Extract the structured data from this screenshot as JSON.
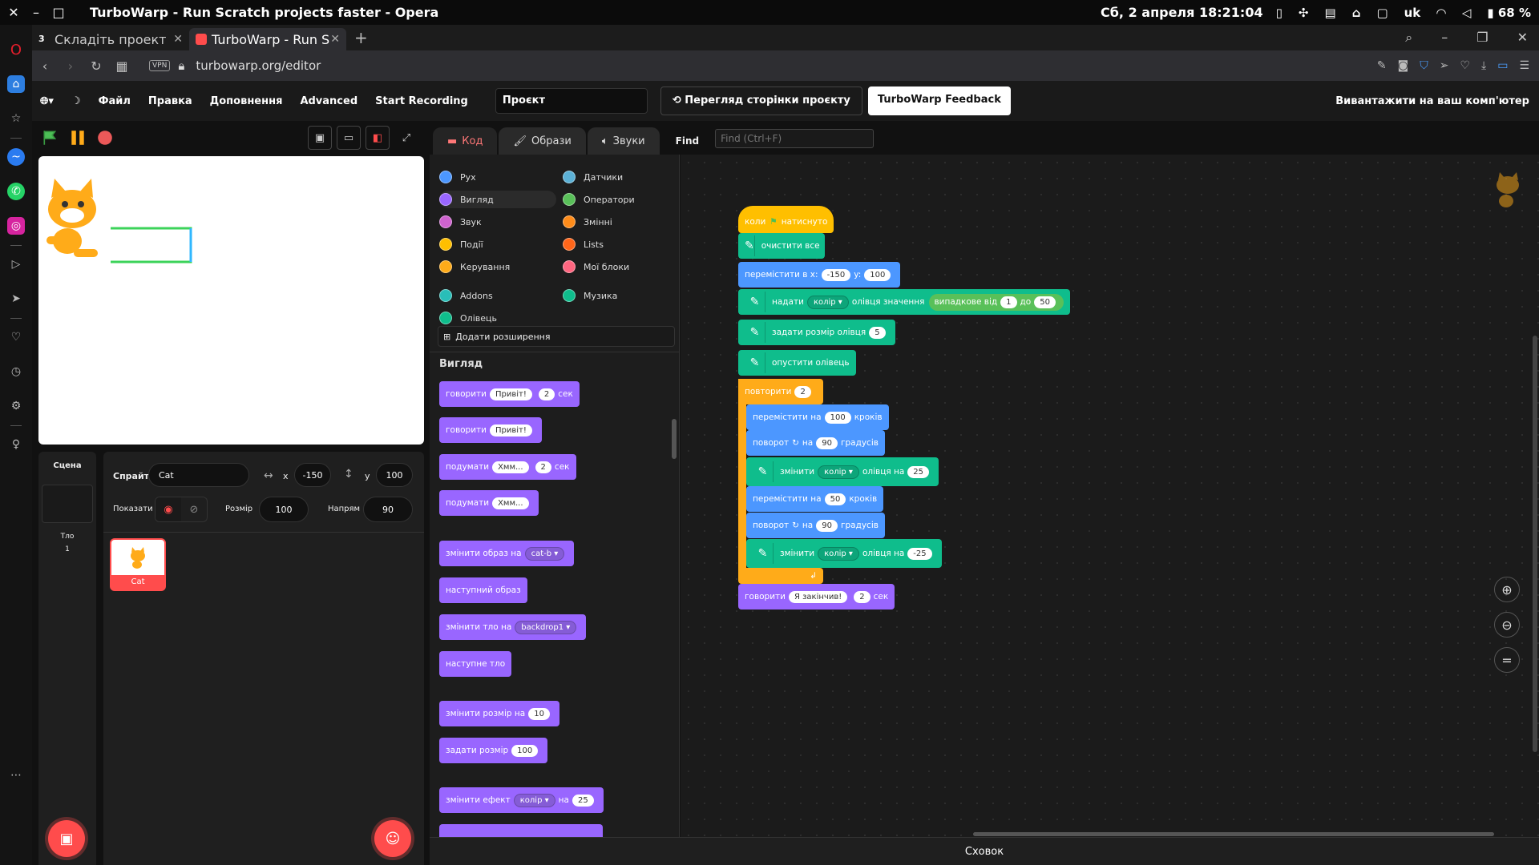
{
  "os": {
    "title": "TurboWarp - Run Scratch projects faster - Opera",
    "datetime": "Сб, 2 апреля 18:21:04",
    "lang": "uk",
    "battery": "68 %"
  },
  "tabs": [
    {
      "label": "Складіть проект",
      "badge": "3"
    },
    {
      "label": "TurboWarp - Run S"
    }
  ],
  "address": {
    "url": "turbowarp.org/editor",
    "vpn": "VPN"
  },
  "menu": {
    "file": "Файл",
    "edit": "Правка",
    "addons": "Доповнення",
    "advanced": "Advanced",
    "record": "Start Recording",
    "project_title": "Проєкт",
    "view_page": "Перегляд сторінки проєкту",
    "feedback": "TurboWarp Feedback",
    "save": "Вивантажити на ваш комп'ютер"
  },
  "code_tabs": {
    "code": "Код",
    "costumes": "Образи",
    "sounds": "Звуки",
    "find": "Find",
    "find_placeholder": "Find (Ctrl+F)"
  },
  "categories": [
    {
      "label": "Рух",
      "color": "#4c97ff"
    },
    {
      "label": "Датчики",
      "color": "#5cb1d6"
    },
    {
      "label": "Вигляд",
      "color": "#9966ff"
    },
    {
      "label": "Оператори",
      "color": "#59c059"
    },
    {
      "label": "Звук",
      "color": "#cf63cf"
    },
    {
      "label": "Змінні",
      "color": "#ff8c1a"
    },
    {
      "label": "Події",
      "color": "#ffbf00"
    },
    {
      "label": "Lists",
      "color": "#ff661a"
    },
    {
      "label": "Керування",
      "color": "#ffab19"
    },
    {
      "label": "Мої блоки",
      "color": "#ff6680"
    },
    {
      "label": "Addons",
      "color": "#29beb8"
    },
    {
      "label": "Музика",
      "color": "#0fbd8c"
    },
    {
      "label": "Олівець",
      "color": "#0fbd8c"
    }
  ],
  "extensions_button": "Додати розширення",
  "palette_heading": "Вигляд",
  "palette": {
    "say_for": [
      "говорити",
      "Привіт!",
      "2",
      "сек"
    ],
    "say": [
      "говорити",
      "Привіт!"
    ],
    "think_for": [
      "подумати",
      "Хмм...",
      "2",
      "сек"
    ],
    "think": [
      "подумати",
      "Хмм..."
    ],
    "switch_costume": [
      "змінити образ на",
      "cat-b"
    ],
    "next_costume": "наступний образ",
    "switch_backdrop": [
      "змінити тло на",
      "backdrop1"
    ],
    "next_backdrop": "наступне тло",
    "change_size": [
      "змінити розмір на",
      "10"
    ],
    "set_size": [
      "задати розмір",
      "100"
    ],
    "change_effect": [
      "змінити ефект",
      "колір",
      "на",
      "25"
    ]
  },
  "script": {
    "hat": [
      "коли",
      "натиснуто"
    ],
    "clear": "очистити все",
    "goto": [
      "перемістити в x:",
      "-150",
      "y:",
      "100"
    ],
    "set_pen": [
      "надати",
      "колір",
      "олівця значення",
      "випадкове від",
      "1",
      "до",
      "50"
    ],
    "pen_size": [
      "задати розмір олівця",
      "5"
    ],
    "pen_down": "опустити олівець",
    "repeat": [
      "повторити",
      "2"
    ],
    "move1": [
      "перемістити на",
      "100",
      "кроків"
    ],
    "turn1": [
      "поворот",
      "на",
      "90",
      "градусів"
    ],
    "change1": [
      "змінити",
      "колір",
      "олівця на",
      "25"
    ],
    "move2": [
      "перемістити на",
      "50",
      "кроків"
    ],
    "turn2": [
      "поворот",
      "на",
      "90",
      "градусів"
    ],
    "change2": [
      "змінити",
      "колір",
      "олівця на",
      "-25"
    ],
    "say_end": [
      "говорити",
      "Я закінчив!",
      "2",
      "сек"
    ]
  },
  "sprite_info": {
    "sprite_label": "Спрайт",
    "name": "Cat",
    "x_label": "x",
    "x": "-150",
    "y_label": "y",
    "y": "100",
    "show_label": "Показати",
    "size_label": "Розмір",
    "size": "100",
    "dir_label": "Напрям",
    "direction": "90"
  },
  "sprites": [
    {
      "name": "Cat"
    }
  ],
  "scene": {
    "title": "Сцена",
    "backdrop_label": "Тло",
    "backdrop_count": "1"
  },
  "backpack": "Сховок"
}
